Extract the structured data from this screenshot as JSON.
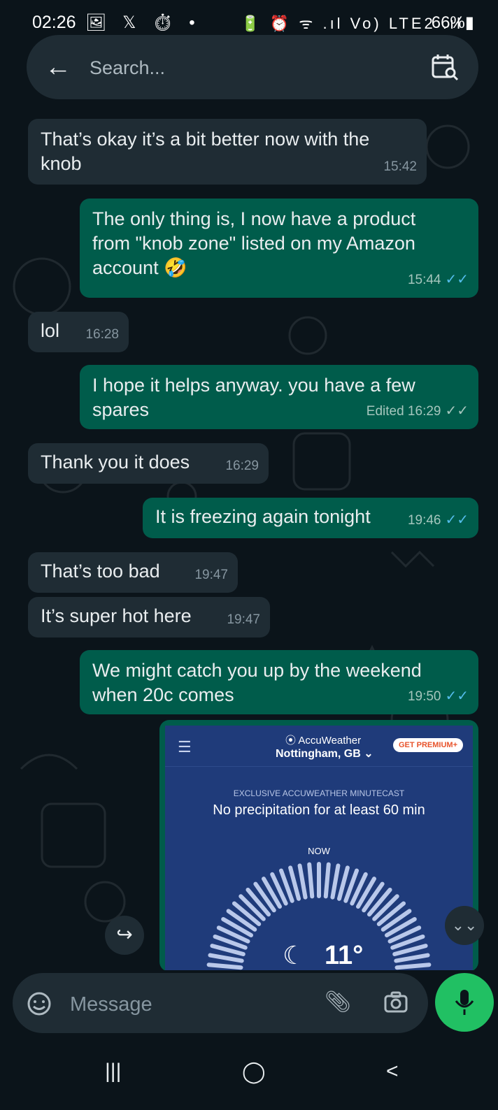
{
  "status_bar": {
    "time": "02:26",
    "left_icons": "🖼 𝕏 ⏱ •",
    "right_icons": "🔋 ⏰ ᯤ .ıl Vo) LTE2 .ıl",
    "battery": "66%"
  },
  "header": {
    "search_placeholder": "Search..."
  },
  "messages": [
    {
      "dir": "in",
      "text": "That’s okay it’s a bit better now with the\nknob",
      "time": "15:42"
    },
    {
      "dir": "out",
      "text": "The only thing is, I now have a product\nfrom \"knob zone\" listed on my Amazon\naccount 🤣",
      "time": "15:44",
      "ticks": "read"
    },
    {
      "dir": "in",
      "text": "lol",
      "time": "16:28"
    },
    {
      "dir": "out",
      "text": "I hope it helps anyway. you have a few\nspares",
      "time": "Edited 16:29",
      "ticks": "delivered"
    },
    {
      "dir": "in",
      "text": "Thank you it does",
      "time": "16:29"
    },
    {
      "dir": "out",
      "text": "It is freezing again tonight",
      "time": "19:46",
      "ticks": "read"
    },
    {
      "dir": "in",
      "text": "That’s too bad",
      "time": "19:47"
    },
    {
      "dir": "in",
      "text": "It’s super hot here",
      "time": "19:47"
    },
    {
      "dir": "out",
      "text": "We might catch you up by the weekend\nwhen 20c comes",
      "time": "19:50",
      "ticks": "read"
    }
  ],
  "image_message": {
    "brand": "AccuWeather",
    "location": "Nottingham, GB",
    "premium_label": "GET PREMIUM+",
    "minutecast_label": "EXCLUSIVE ACCUWEATHER MINUTECAST",
    "precip_text": "No precipitation for at least 60 min",
    "now_label": "NOW",
    "temperature": "11°",
    "menu_icon": "hamburger-icon",
    "moon_icon": "crescent-moon-icon"
  },
  "input": {
    "placeholder": "Message"
  },
  "colors": {
    "background": "#0b141a",
    "incoming_bubble": "#1f2c34",
    "outgoing_bubble": "#005c4b",
    "read_tick": "#53bdeb",
    "mic_button": "#21c063",
    "weather_bg": "#1f3b7a"
  },
  "icons": {
    "back": "arrow-left-icon",
    "calendar_search": "calendar-search-icon",
    "forward": "forward-icon",
    "scroll_down": "double-chevron-down-icon",
    "sticker": "sticker-icon",
    "attach": "paperclip-icon",
    "camera": "camera-icon",
    "mic": "microphone-icon"
  },
  "nav": {
    "recents": "|||",
    "home": "◯",
    "back": "<"
  }
}
